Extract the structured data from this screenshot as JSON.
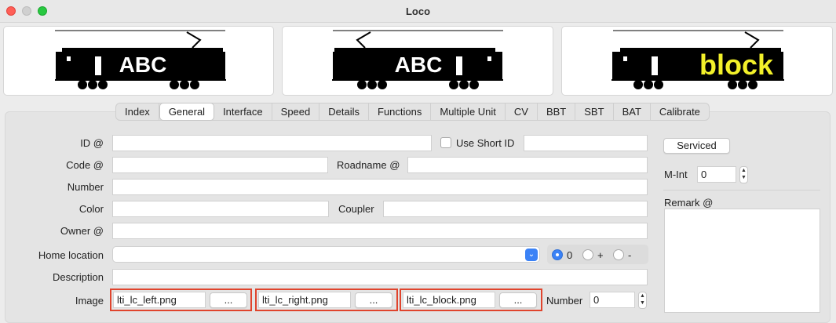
{
  "window": {
    "title": "Loco"
  },
  "previews": [
    {
      "name": "left",
      "text": "ABC"
    },
    {
      "name": "right",
      "text": "ABC"
    },
    {
      "name": "block",
      "text": "block"
    }
  ],
  "tabs": [
    "Index",
    "General",
    "Interface",
    "Speed",
    "Details",
    "Functions",
    "Multiple Unit",
    "CV",
    "BBT",
    "SBT",
    "BAT",
    "Calibrate"
  ],
  "active_tab": "General",
  "form": {
    "id_label": "ID @",
    "id_value": "",
    "use_short_id_label": "Use Short ID",
    "short_id_value": "",
    "code_label": "Code @",
    "code_value": "",
    "roadname_label": "Roadname @",
    "roadname_value": "",
    "number_label": "Number",
    "number_value": "",
    "color_label": "Color",
    "color_value": "",
    "coupler_label": "Coupler",
    "coupler_value": "",
    "owner_label": "Owner @",
    "owner_value": "",
    "home_location_label": "Home location",
    "home_location_value": "",
    "radio_0_label": "0",
    "radio_plus_label": "+",
    "radio_minus_label": "-",
    "description_label": "Description",
    "description_value": "",
    "image_label": "Image",
    "image_left": "lti_lc_left.png",
    "image_right": "lti_lc_right.png",
    "image_block": "lti_lc_block.png",
    "browse_label": "...",
    "image_number_label": "Number",
    "image_number_value": "0"
  },
  "side": {
    "serviced_label": "Serviced",
    "mint_label": "M-Int",
    "mint_value": "0",
    "remark_label": "Remark @",
    "remark_value": ""
  },
  "colors": {
    "highlight": "#e0442d",
    "accent": "#3b82f6",
    "block_text": "#f2f02a"
  }
}
